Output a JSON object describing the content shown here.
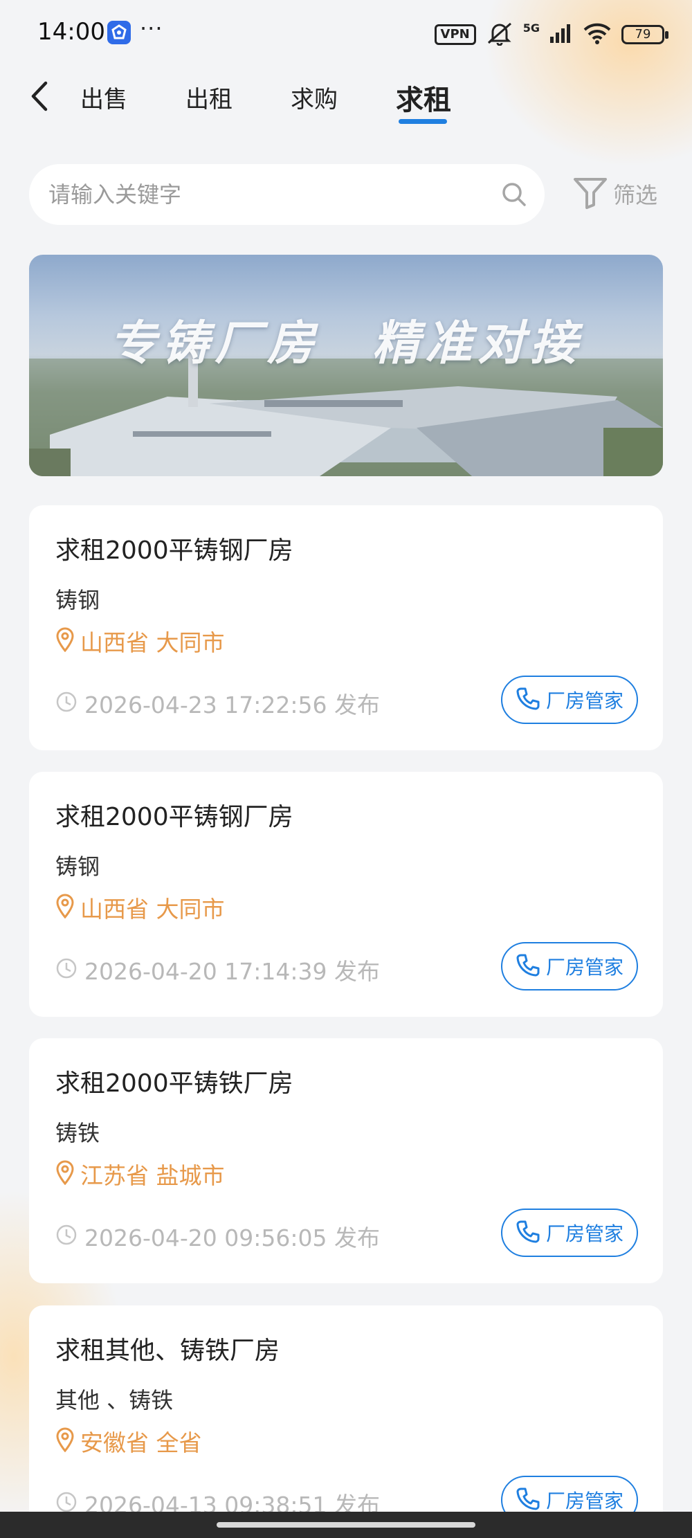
{
  "status_bar": {
    "time": "14:00",
    "dots": "···",
    "vpn": "VPN",
    "network": "5G",
    "battery": "79"
  },
  "nav": {
    "tabs": [
      {
        "label": "出售"
      },
      {
        "label": "出租"
      },
      {
        "label": "求购"
      },
      {
        "label": "求租"
      }
    ],
    "active_tab": "求租"
  },
  "search": {
    "placeholder": "请输入关键字"
  },
  "filter": {
    "label": "筛选"
  },
  "banner": {
    "text": "专铸厂房　精准对接"
  },
  "listings": [
    {
      "title": "求租2000平铸钢厂房",
      "type": "铸钢",
      "location": "山西省 大同市",
      "time": "2026-04-23 17:22:56 发布",
      "contact_label": "厂房管家"
    },
    {
      "title": "求租2000平铸钢厂房",
      "type": "铸钢",
      "location": "山西省 大同市",
      "time": "2026-04-20 17:14:39 发布",
      "contact_label": "厂房管家"
    },
    {
      "title": "求租2000平铸铁厂房",
      "type": "铸铁",
      "location": "江苏省 盐城市",
      "time": "2026-04-20 09:56:05 发布",
      "contact_label": "厂房管家"
    },
    {
      "title": "求租其他、铸铁厂房",
      "type": "其他 、铸铁",
      "location": "安徽省 全省",
      "time": "2026-04-13 09:38:51 发布",
      "contact_label": "厂房管家"
    }
  ],
  "colors": {
    "accent": "#1f7fe0",
    "location": "#e7994a",
    "meta": "#b8b8b8",
    "background": "#f3f4f6"
  },
  "icons": [
    "back-arrow-icon",
    "search-icon",
    "filter-funnel-icon",
    "location-pin-icon",
    "clock-icon",
    "phone-icon",
    "wifi-icon",
    "mute-bell-icon",
    "signal-icon",
    "battery-icon"
  ]
}
